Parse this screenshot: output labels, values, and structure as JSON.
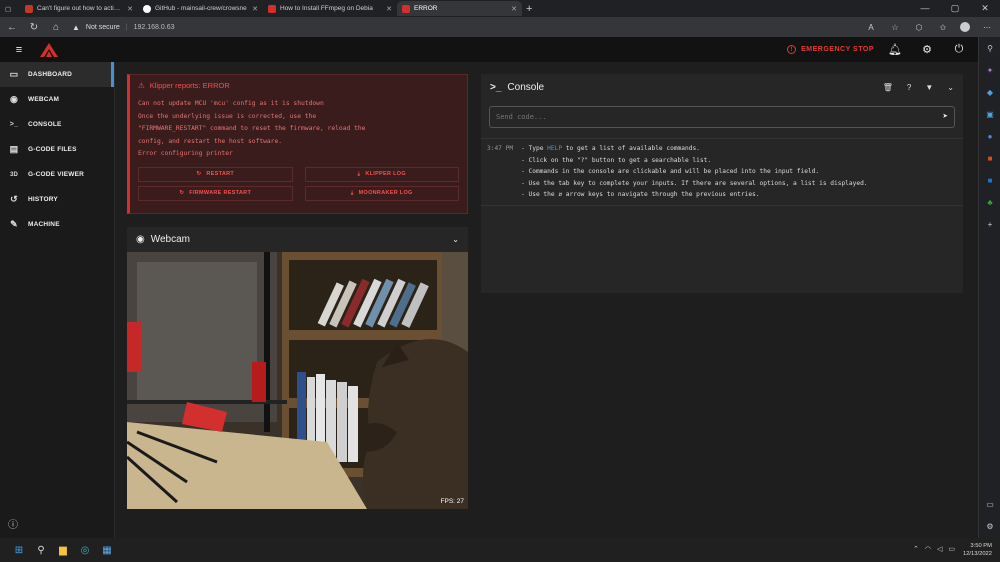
{
  "browser": {
    "tabs": [
      {
        "title": "Can't figure out how to activate ·",
        "fav_color": "#c0392b",
        "active": false
      },
      {
        "title": "GitHub - mainsail-crew/crowsne",
        "fav_color": "#ffffff",
        "active": false
      },
      {
        "title": "How to Install FFmpeg on Debia",
        "fav_color": "#d32f2f",
        "active": false
      },
      {
        "title": "ERROR",
        "fav_color": "#d32f2f",
        "active": true
      }
    ],
    "security": "Not secure",
    "url": "192.168.0.63"
  },
  "header": {
    "emergency_stop": "EMERGENCY STOP",
    "accent": "#e53935"
  },
  "sidebar": {
    "items": [
      {
        "label": "DASHBOARD",
        "icon": "monitor-dashboard-icon",
        "glyph": "▭",
        "active": true
      },
      {
        "label": "WEBCAM",
        "icon": "webcam-icon",
        "glyph": "◉",
        "active": false
      },
      {
        "label": "CONSOLE",
        "icon": "console-icon",
        "glyph": ">_",
        "active": false
      },
      {
        "label": "G-CODE FILES",
        "icon": "file-icon",
        "glyph": "▤",
        "active": false
      },
      {
        "label": "G-CODE VIEWER",
        "icon": "3d-icon",
        "glyph": "3D",
        "active": false
      },
      {
        "label": "HISTORY",
        "icon": "history-icon",
        "glyph": "↺",
        "active": false
      },
      {
        "label": "MACHINE",
        "icon": "wrench-icon",
        "glyph": "✎",
        "active": false
      }
    ]
  },
  "error": {
    "title": "Klipper reports: ERROR",
    "message": "Can not update MCU 'mcu' config as it is shutdown\nOnce the underlying issue is corrected, use the\n\"FIRMWARE_RESTART\" command to reset the firmware, reload the\nconfig, and restart the host software.\nError configuring printer",
    "buttons": {
      "restart": "RESTART",
      "klipper_log": "KLIPPER LOG",
      "firmware_restart": "FIRMWARE RESTART",
      "moonraker_log": "MOONRAKER LOG"
    }
  },
  "webcam": {
    "title": "Webcam",
    "fps": "FPS: 27"
  },
  "console": {
    "title": "Console",
    "placeholder": "Send code...",
    "time": "3:47 PM",
    "help_word": "HELP",
    "line1_prefix": "- Type ",
    "line1_suffix": " to get a list of available commands.",
    "lines": [
      "- Click on the \"?\" button to get a searchable list.",
      "- Commands in the console are clickable and will be placed into the input field.",
      "- Use the tab key to complete your inputs. If there are several options, a list is displayed.",
      "- Use the ⇵ arrow keys to navigate through the previous entries."
    ]
  },
  "taskbar": {
    "time": "3:50 PM",
    "date": "12/13/2022"
  }
}
